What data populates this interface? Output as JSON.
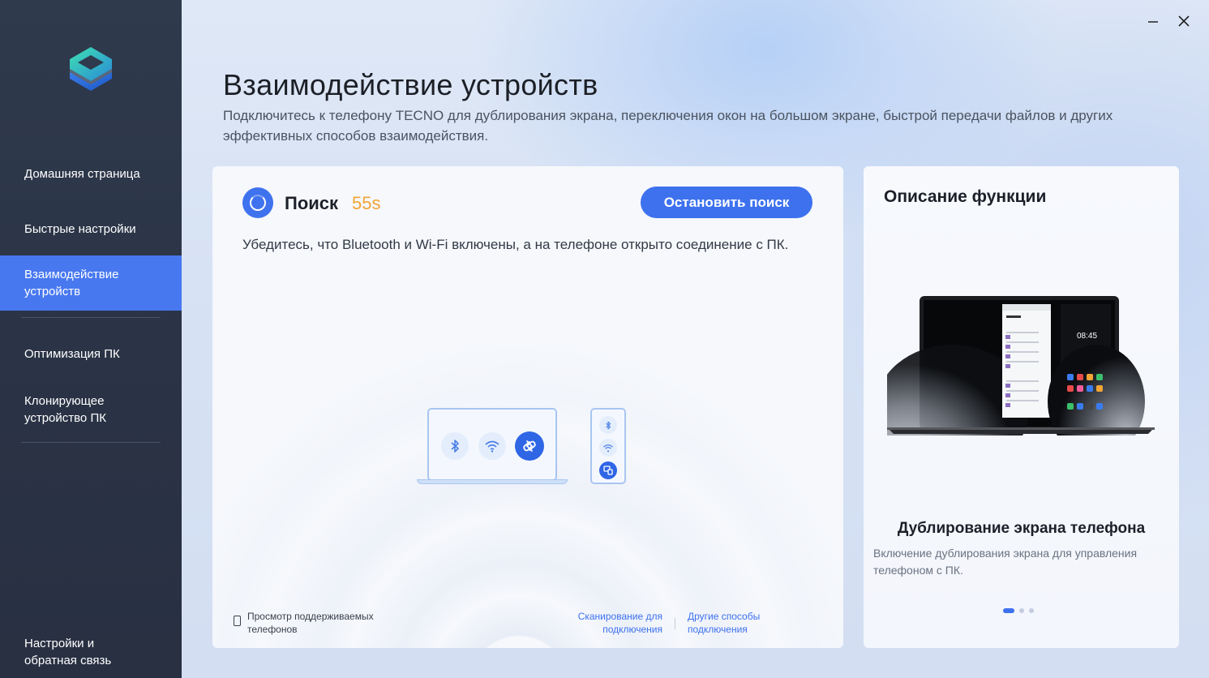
{
  "sidebar": {
    "items": [
      {
        "label": "Домашняя страница"
      },
      {
        "label": "Быстрые настройки"
      },
      {
        "label": "Взаимодействие устройств"
      },
      {
        "label": "Оптимизация ПК"
      },
      {
        "label": "Клонирующее устройство ПК"
      }
    ],
    "bottom_label": "Настройки и обратная связь",
    "active_index": 2
  },
  "window": {
    "minimize_icon": "minimize-icon",
    "close_icon": "close-icon"
  },
  "header": {
    "title": "Взаимодействие устройств",
    "description": "Подключитесь к телефону TECNO для дублирования экрана, переключения окон на большом экране, быстрой передачи файлов и других эффективных способов взаимодействия."
  },
  "search": {
    "label": "Поиск",
    "timer": "55s",
    "stop_button": "Остановить поиск",
    "hint": "Убедитесь, что Bluetooth и Wi-Fi включены, а на телефоне открыто соединение с ПК.",
    "supported_phones_link": "Просмотр поддерживаемых телефонов",
    "scan_link": "Сканирование для подключения",
    "other_link": "Другие способы подключения"
  },
  "description": {
    "title": "Описание функции",
    "feature_title": "Дублирование экрана телефона",
    "feature_desc": "Включение дублирования экрана для управления телефоном с ПК.",
    "phone_time": "08:45",
    "carousel_total": 3,
    "carousel_active": 0
  },
  "colors": {
    "accent": "#3d71ee",
    "timer": "#f2a436",
    "sidebar_bg": "#2f3a4d",
    "sidebar_active": "#4878f0"
  }
}
